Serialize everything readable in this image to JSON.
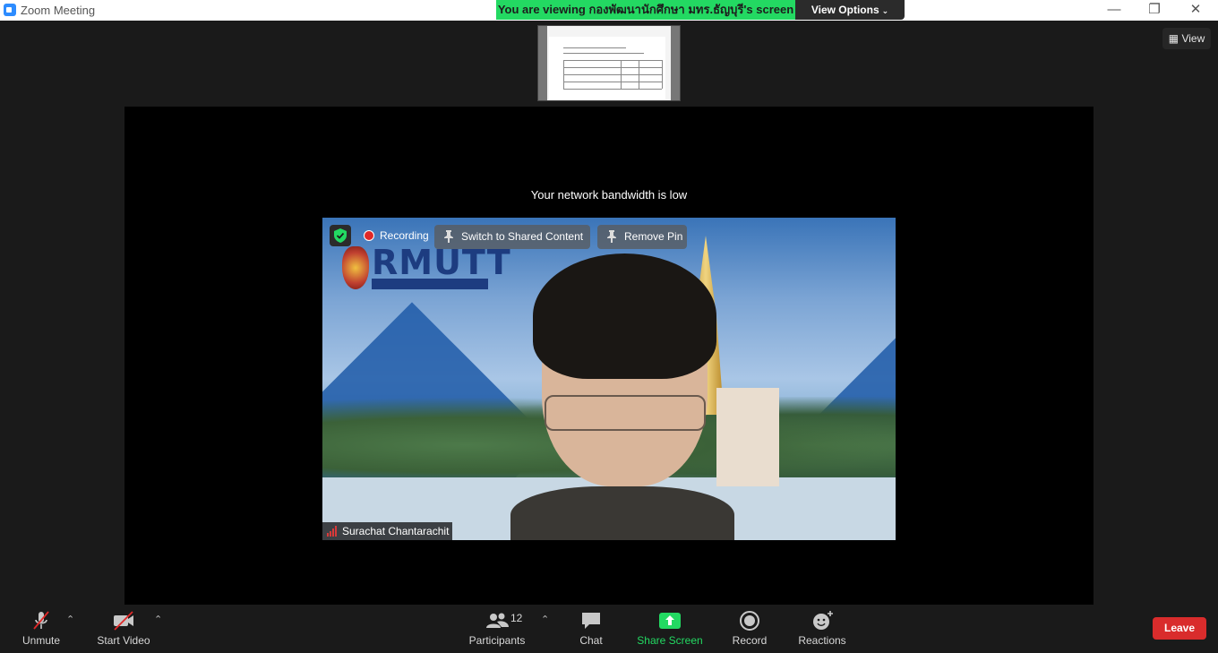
{
  "window": {
    "title": "Zoom Meeting",
    "minimize_glyph": "—",
    "restore_glyph": "❐",
    "close_glyph": "✕"
  },
  "share_banner": {
    "text": "You are viewing กองพัฒนานักศึกษา มทร.ธัญบุรี's screen",
    "color": "#23d962",
    "view_options_label": "View Options"
  },
  "view_button": {
    "label": "View",
    "icon": "layout-grid-icon"
  },
  "stage": {
    "network_warning": "Your network bandwidth is low"
  },
  "video": {
    "recording_label": "Recording",
    "switch_button": "Switch to Shared Content",
    "remove_pin_button": "Remove Pin",
    "participant_name": "Surachat Chantarachit",
    "background_logo_text": "RMUTT",
    "recording_color": "#e02828"
  },
  "toolbar": {
    "unmute": "Unmute",
    "start_video": "Start Video",
    "participants": "Participants",
    "participant_count": "12",
    "chat": "Chat",
    "share_screen": "Share Screen",
    "record": "Record",
    "reactions": "Reactions",
    "leave": "Leave",
    "share_color": "#23d962",
    "leave_color": "#d92c2c"
  }
}
